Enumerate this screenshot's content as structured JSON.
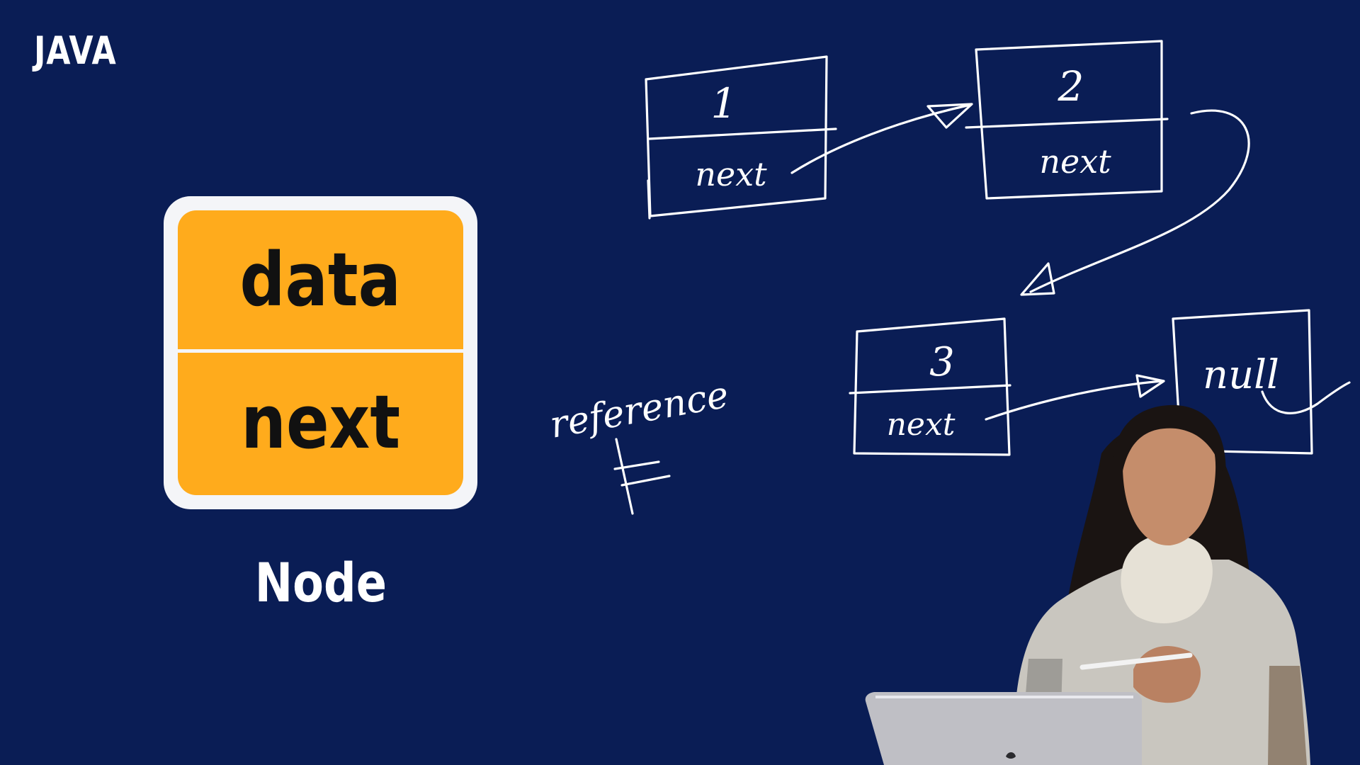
{
  "brand": "JAVA",
  "node": {
    "top_field": "data",
    "bottom_field": "next",
    "caption": "Node"
  },
  "sketch": {
    "annotation": "reference",
    "nodes": [
      {
        "value": "1",
        "pointer": "next"
      },
      {
        "value": "2",
        "pointer": "next"
      },
      {
        "value": "3",
        "pointer": "next"
      }
    ],
    "terminal": "null"
  },
  "colors": {
    "background": "#0a1d55",
    "node_fill": "#ffab1c",
    "node_frame": "#f4f5f8",
    "ink": "#ffffff"
  }
}
